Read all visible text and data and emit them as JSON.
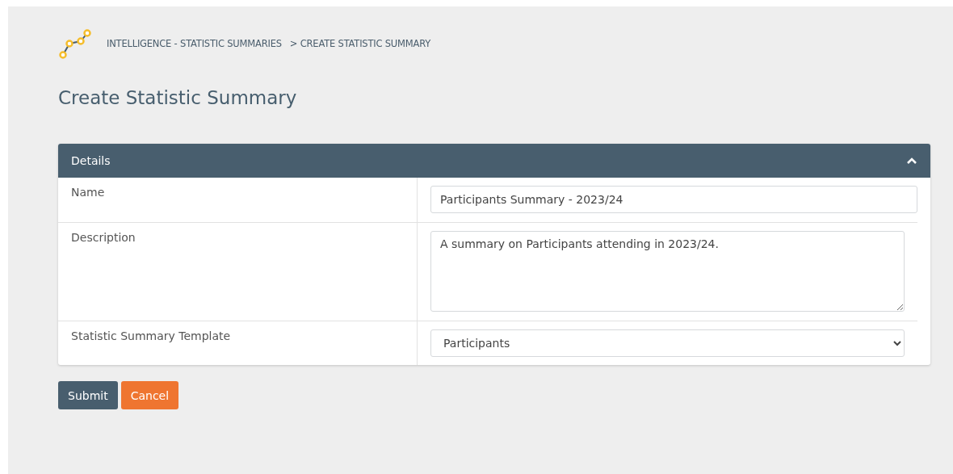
{
  "breadcrumb": [
    {
      "label": "INTELLIGENCE - STATISTIC SUMMARIES"
    },
    {
      "label": "> CREATE STATISTIC SUMMARY"
    }
  ],
  "page_title": "Create Statistic Summary",
  "panel": {
    "title": "Details",
    "expanded": true,
    "fields": [
      {
        "kind": "text",
        "label": "Name",
        "value": "Participants Summary - 2023/24"
      },
      {
        "kind": "textarea",
        "label": "Description",
        "value": "A summary on Participants attending in 2023/24."
      },
      {
        "kind": "select",
        "label": "Statistic Summary Template",
        "value": "Participants"
      }
    ]
  },
  "buttons": [
    {
      "kind": "primary",
      "label": "Submit"
    },
    {
      "kind": "danger",
      "label": "Cancel"
    }
  ]
}
